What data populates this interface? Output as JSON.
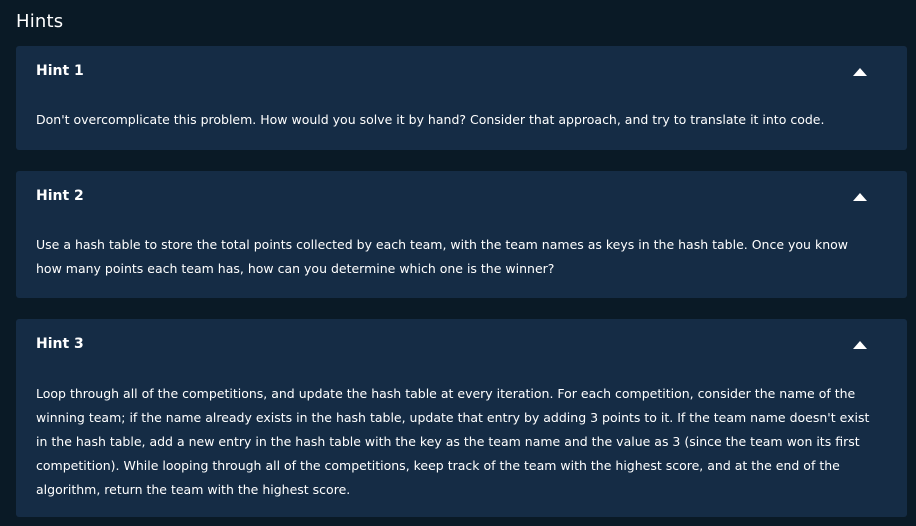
{
  "section_title": "Hints",
  "hints": [
    {
      "title": "Hint 1",
      "text": "Don't overcomplicate this problem. How would you solve it by hand? Consider that approach, and try to translate it into code."
    },
    {
      "title": "Hint 2",
      "text": "Use a hash table to store the total points collected by each team, with the team names as keys in the hash table. Once you know how many points each team has, how can you determine which one is the winner?"
    },
    {
      "title": "Hint 3",
      "text": "Loop through all of the competitions, and update the hash table at every iteration. For each competition, consider the name of the winning team; if the name already exists in the hash table, update that entry by adding 3 points to it. If the team name doesn't exist in the hash table, add a new entry in the hash table with the key as the team name and the value as 3 (since the team won its first competition). While looping through all of the competitions, keep track of the team with the highest score, and at the end of the algorithm, return the team with the highest score."
    }
  ],
  "icons": {
    "toggle": "caret-up-icon"
  }
}
